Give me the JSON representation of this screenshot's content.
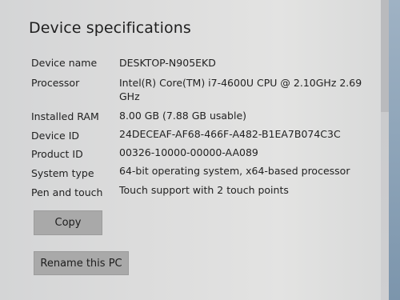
{
  "section": {
    "title": "Device specifications"
  },
  "specs": [
    {
      "label": "Device name",
      "value": "DESKTOP-N905EKD"
    },
    {
      "label": "Processor",
      "value": "Intel(R) Core(TM) i7-4600U CPU @ 2.10GHz   2.69 GHz"
    },
    {
      "label": "Installed RAM",
      "value": "8.00 GB (7.88 GB usable)"
    },
    {
      "label": "Device ID",
      "value": "24DECEAF-AF68-466F-A482-B1EA7B074C3C"
    },
    {
      "label": "Product ID",
      "value": "00326-10000-00000-AA089"
    },
    {
      "label": "System type",
      "value": "64-bit operating system, x64-based processor"
    },
    {
      "label": "Pen and touch",
      "value": "Touch support with 2 touch points"
    }
  ],
  "buttons": {
    "copy": "Copy",
    "rename": "Rename this PC"
  }
}
